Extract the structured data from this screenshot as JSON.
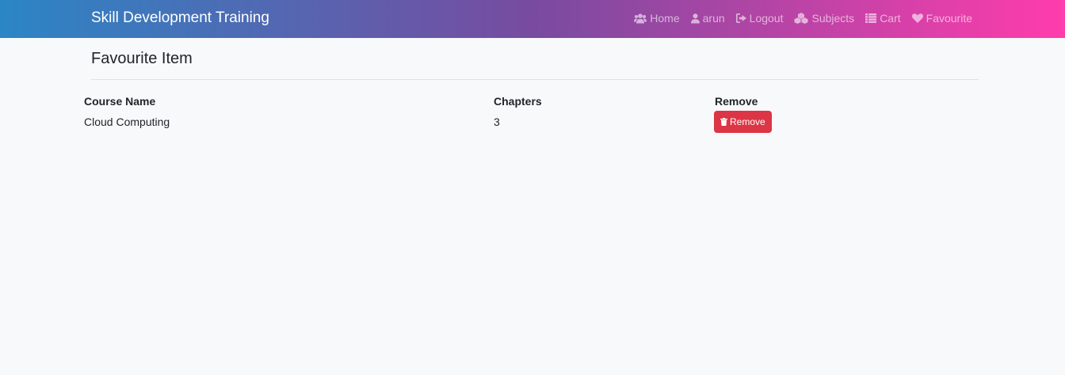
{
  "navbar": {
    "brand": "Skill Development Training",
    "links": [
      {
        "label": "Home",
        "icon": "users-icon"
      },
      {
        "label": "arun",
        "icon": "user-icon"
      },
      {
        "label": "Logout",
        "icon": "sign-out-icon"
      },
      {
        "label": "Subjects",
        "icon": "cubes-icon"
      },
      {
        "label": "Cart",
        "icon": "list-icon"
      },
      {
        "label": "Favourite",
        "icon": "heart-icon"
      }
    ]
  },
  "page": {
    "title": "Favourite Item"
  },
  "table": {
    "headers": [
      "Course Name",
      "Chapters",
      "Remove"
    ],
    "rows": [
      {
        "course_name": "Cloud Computing",
        "chapters": "3",
        "remove_label": "Remove"
      }
    ]
  },
  "colors": {
    "gradient_start": "#2b86c5",
    "gradient_mid": "#784ba0",
    "gradient_end": "#ff3cac",
    "remove_button": "#dc3545",
    "background": "#f8f9fa"
  }
}
